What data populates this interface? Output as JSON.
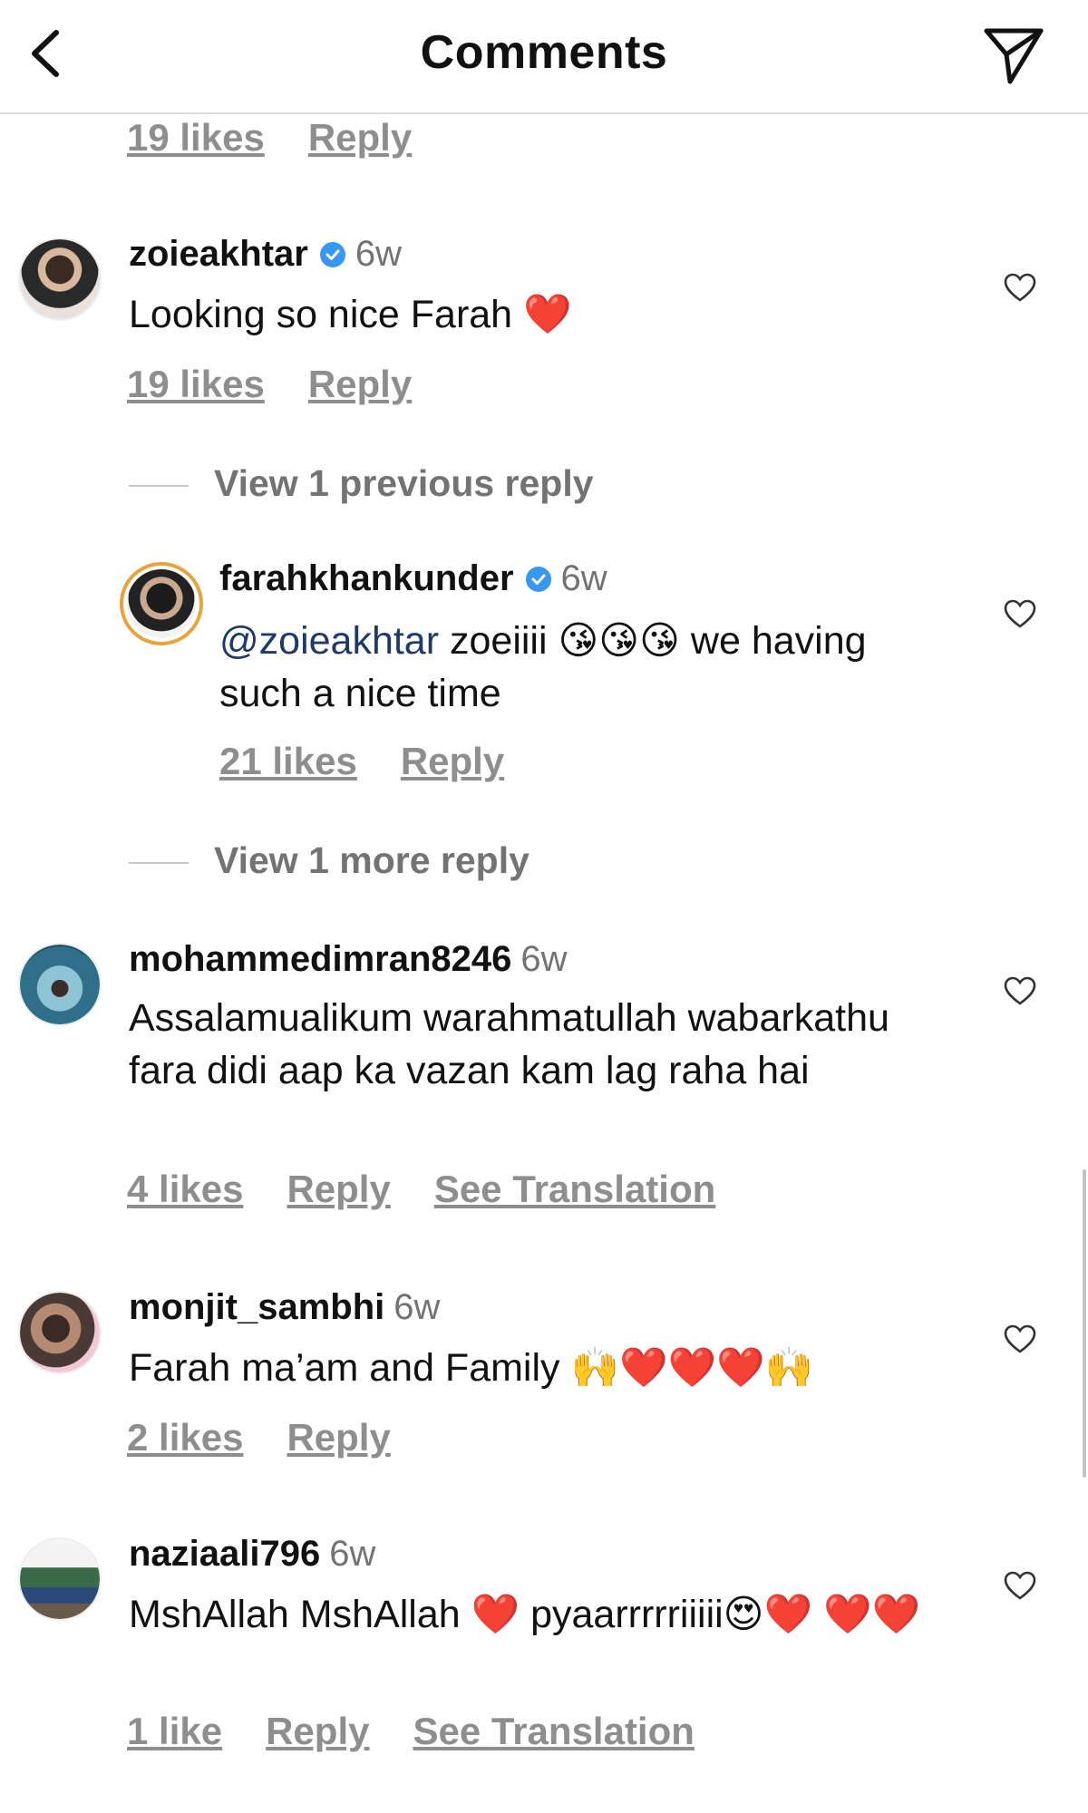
{
  "header": {
    "title": "Comments",
    "back_icon": "chevron-left-icon",
    "share_icon": "paper-plane-icon"
  },
  "top_partial": {
    "likes": "19 likes",
    "reply": "Reply"
  },
  "comments": [
    {
      "username": "zoieakhtar",
      "verified": true,
      "time": "6w",
      "text": "Looking so nice Farah ❤️",
      "likes": "19 likes",
      "reply": "Reply"
    },
    {
      "username": "farahkhankunder",
      "verified": true,
      "time": "6w",
      "mention": "@zoieakhtar",
      "text": " zoeiiii 😘😘😘 we having such a nice time",
      "likes": "21 likes",
      "reply": "Reply"
    },
    {
      "username": "mohammedimran8246",
      "verified": false,
      "time": "6w",
      "text": "Assalamualikum warahmatullah wabarkathu fara didi aap ka vazan kam lag raha hai",
      "likes": "4 likes",
      "reply": "Reply",
      "translate": "See Translation"
    },
    {
      "username": "monjit_sambhi",
      "verified": false,
      "time": "6w",
      "text": "Farah ma’am and Family 🙌❤️❤️❤️🙌",
      "likes": "2 likes",
      "reply": "Reply"
    },
    {
      "username": "naziaali796",
      "verified": false,
      "time": "6w",
      "text": "MshAllah MshAllah ❤️ pyaarrrrriiiii😍❤️ ❤️❤️",
      "likes": "1 like",
      "reply": "Reply",
      "translate": "See Translation"
    }
  ],
  "view_previous": "View 1 previous reply",
  "view_more": "View 1 more reply",
  "colors": {
    "verified": "#3897f0",
    "secondary": "#737373",
    "story_ring": "#e8a33b"
  }
}
